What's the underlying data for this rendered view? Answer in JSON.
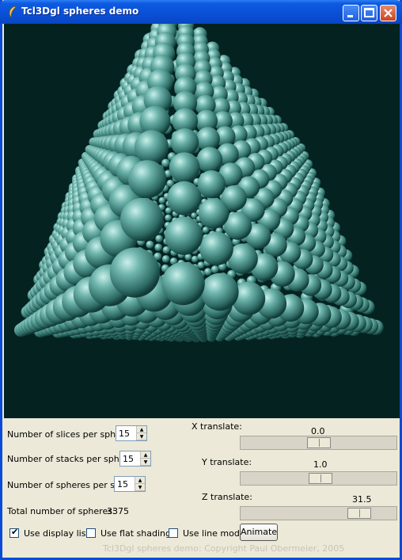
{
  "window": {
    "title": "Tcl3Dgl spheres demo"
  },
  "controls": {
    "slices_label": "Number of slices per sphere:",
    "slices_value": "15",
    "stacks_label": "Number of stacks per sphere:",
    "stacks_value": "15",
    "spheres_label": "Number of spheres per side:",
    "spheres_value": "15",
    "total_label": "Total number of spheres:",
    "total_value": "3375",
    "x_label": "X translate:",
    "x_value": "0.0",
    "y_label": "Y translate:",
    "y_value": "1.0",
    "z_label": "Z translate:",
    "z_value": "31.5",
    "display_list_label": "Use display list",
    "display_list_checked": true,
    "flat_shading_label": "Use flat shading",
    "line_mode_label": "Use line mode",
    "animate_label": "Animate"
  },
  "footer": {
    "text": "Tcl3Dgl spheres demo: Copyright Paul Obermeier, 2005"
  },
  "colors": {
    "canvas_bg": "#04221f",
    "sphere": "#5ea9a1",
    "title_bar": "#0a4fd6"
  }
}
